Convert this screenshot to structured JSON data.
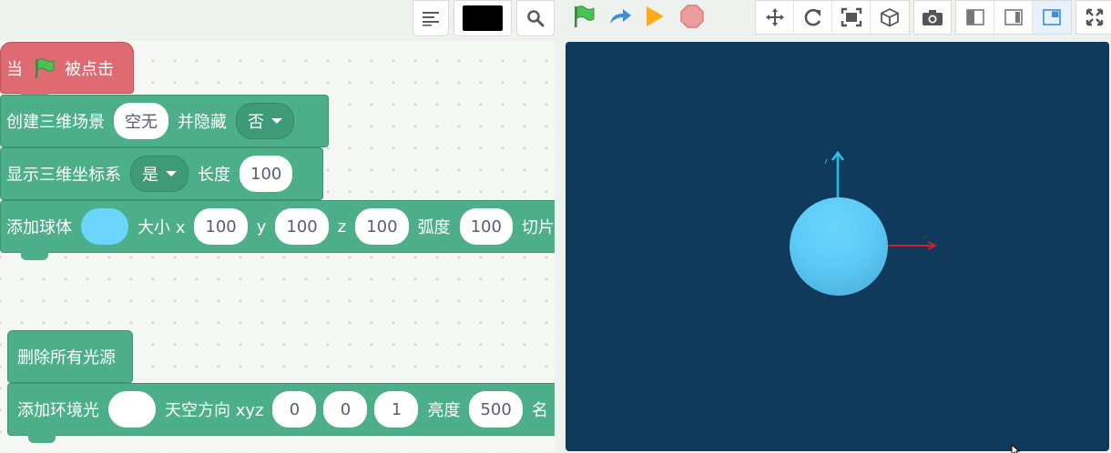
{
  "toolbar": {
    "color_swatch": "#000000",
    "run_colors": {
      "flag": "#4cbf56",
      "step": "#3f8fd6",
      "play": "#ffab19",
      "stop": "#ec9c9c"
    }
  },
  "blocks": {
    "hat": {
      "prefix": "当",
      "suffix": "被点击"
    },
    "create_scene": {
      "label": "创建三维场景",
      "input": "空无",
      "label2": "并隐藏",
      "dropdown": "否"
    },
    "show_axes": {
      "label": "显示三维坐标系",
      "dropdown": "是",
      "label2": "长度",
      "length": "100"
    },
    "add_sphere": {
      "label": "添加球体",
      "color": "#6ad5fd",
      "size_label": "大小 x",
      "x": "100",
      "y_label": "y",
      "y": "100",
      "z_label": "z",
      "z": "100",
      "arc_label": "弧度",
      "arc": "100",
      "cut_label": "切片"
    },
    "remove_lights": {
      "label": "删除所有光源"
    },
    "ambient": {
      "label": "添加环境光",
      "color": "#ffffff",
      "dir_label": "天空方向 xyz",
      "x": "0",
      "y": "0",
      "z": "1",
      "bright_label": "亮度",
      "brightness": "500",
      "trail": "名"
    }
  },
  "stage": {
    "background": "#0f3a5b",
    "sphere_color": "#5ccbf7",
    "axes": {
      "y_color": "#25c3df",
      "x_color": "#d11f2b"
    }
  }
}
